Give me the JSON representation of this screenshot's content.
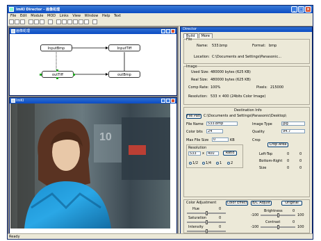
{
  "app": {
    "title": "ImKI Director - 画像処理"
  },
  "menu": [
    "File",
    "Edit",
    "Module",
    "MOD",
    "Links",
    "View",
    "Window",
    "Help",
    "Text"
  ],
  "graph_window": {
    "title": "画像処理"
  },
  "nodes": [
    {
      "label": "InputBmp"
    },
    {
      "label": "InputTiff"
    },
    {
      "label": "outTiff"
    },
    {
      "label": "outBmp"
    }
  ],
  "image_window": {
    "title": "ImKI"
  },
  "image_overlay": "10",
  "status_text": "Ready",
  "side_panel": {
    "title": "Director",
    "tabs": [
      "Build",
      "More"
    ],
    "file": {
      "group": "File",
      "name_label": "Name:",
      "name_value": "533.bmp",
      "format_label": "Format:",
      "format_value": "bmp",
      "location_label": "Location:",
      "location_value": "C:\\Documents and Settings\\Panasonic..."
    },
    "image": {
      "group": "Image",
      "used_label": "Used Size:",
      "used_value": "480000 bytes (625 KB)",
      "real_label": "Real Size:",
      "real_value": "480000 bytes (625 KB)",
      "comp_label": "Comp Rate:",
      "comp_value": "100%",
      "pixels_label": "Pixels:",
      "pixels_value": "215000",
      "res_label": "Resolution:",
      "res_value": "533 × 400 (24bits Color Image)"
    },
    "dest": {
      "group": "Destination Info",
      "path_button": "File Path",
      "path_value": "C:\\Documents and Settings\\Panasonic\\Desktop\\",
      "filename_label": "File Name",
      "filename_value": "533.bmp",
      "imagetype_label": "Image Type",
      "imagetype_value": "jpg",
      "colorbits_label": "Color bits",
      "colorbits_value": "24",
      "quality_label": "Quality",
      "quality_value": "94.7",
      "maxsize_label": "Max File Size",
      "maxsize_value": "0",
      "maxsize_unit": "KB",
      "resolution_label": "Resolution",
      "res_w": "533",
      "res_h": "400",
      "ratio_button": "Ratio",
      "ratio_opts": [
        "1/2",
        "1/4",
        "1",
        "2"
      ],
      "crop_label": "Crop",
      "crop_button": "Crop Area",
      "lefttop_label": "Left-Top",
      "lefttop_x": "0",
      "lefttop_y": "0",
      "bottomright_label": "Bottom-Right",
      "bottomright_x": "0",
      "bottomright_y": "0",
      "size_label": "Size",
      "size_x": "0",
      "size_y": "0"
    },
    "color": {
      "group": "Color Adjustment",
      "color_button": "Color Effect",
      "bc_button": "B/C Adjust",
      "original_button": "Original",
      "hue_label": "Hue",
      "hue_value": "0",
      "saturation_label": "Saturation",
      "saturation_value": "0",
      "intensity_label": "Intensity",
      "intensity_value": "0",
      "brightness_label": "Brightness",
      "brightness_value": "0",
      "contrast_label": "Contrast",
      "contrast_value": "0",
      "min_label": "-100",
      "max_label": "100"
    }
  }
}
